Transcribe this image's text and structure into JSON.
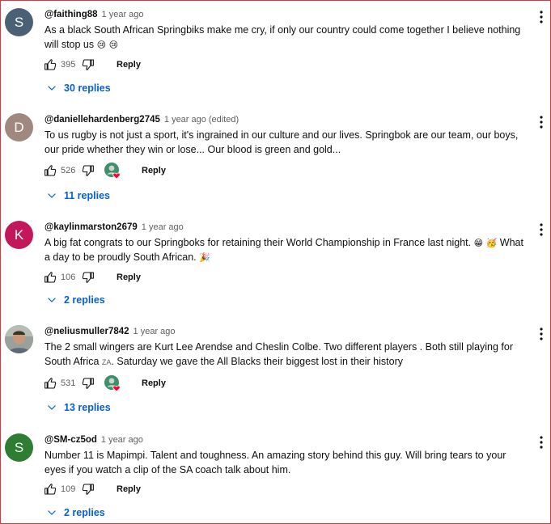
{
  "colors": {
    "border": "#d9363e",
    "link": "#065fd4",
    "muted": "#606060"
  },
  "comments": [
    {
      "author": "@faithing88",
      "time": "1 year ago",
      "edited": "",
      "text": "As a black South African Springbiks make me cry, if only our country could come together I believe nothing will stop us",
      "emojis": "😢 😢",
      "likes": "395",
      "reply_label": "Reply",
      "replies_label": "30 replies",
      "avatar_letter": "S",
      "avatar_color": "#4a6074",
      "creator_heart": false
    },
    {
      "author": "@daniellehardenberg2745",
      "time": "1 year ago",
      "edited": "(edited)",
      "text": "To us rugby is not just a sport, it's ingrained in our culture and our lives. Springbok are our team, our boys, our pride whether they win or lose... Our blood is green and gold...",
      "emojis": "",
      "likes": "526",
      "reply_label": "Reply",
      "replies_label": "11 replies",
      "avatar_letter": "D",
      "avatar_color": "#a1887f",
      "creator_heart": true
    },
    {
      "author": "@kaylinmarston2679",
      "time": "1 year ago",
      "edited": "",
      "text": "A big fat congrats to our Springboks for retaining their World Championship in France last night.",
      "emojis": "😁 🥳",
      "text_after": "What a day to be proudly South African.",
      "emojis_after": "🎉",
      "likes": "106",
      "reply_label": "Reply",
      "replies_label": "2 replies",
      "avatar_letter": "K",
      "avatar_color": "#c2185b",
      "creator_heart": false
    },
    {
      "author": "@neliusmuller7842",
      "time": "1 year ago",
      "edited": "",
      "text": "The 2 small wingers are Kurt Lee Arendse and Cheslin Colbe.  Two different players . Both still playing for South Africa",
      "flag_text": "ZA",
      "text_after": ". Saturday we gave the All Blacks their biggest lost in their history",
      "likes": "531",
      "reply_label": "Reply",
      "replies_label": "13 replies",
      "avatar_letter": "",
      "avatar_color": "#8a8f8c",
      "creator_heart": true
    },
    {
      "author": "@SM-cz5od",
      "time": "1 year ago",
      "edited": "",
      "text": "Number 11 is Mapimpi. Talent and toughness. An amazing story behind this guy.  Will bring tears to your eyes if you watch a clip of the SA coach talk about him.",
      "emojis": "",
      "likes": "109",
      "reply_label": "Reply",
      "replies_label": "2 replies",
      "avatar_letter": "S",
      "avatar_color": "#2e7d32",
      "creator_heart": false
    }
  ]
}
